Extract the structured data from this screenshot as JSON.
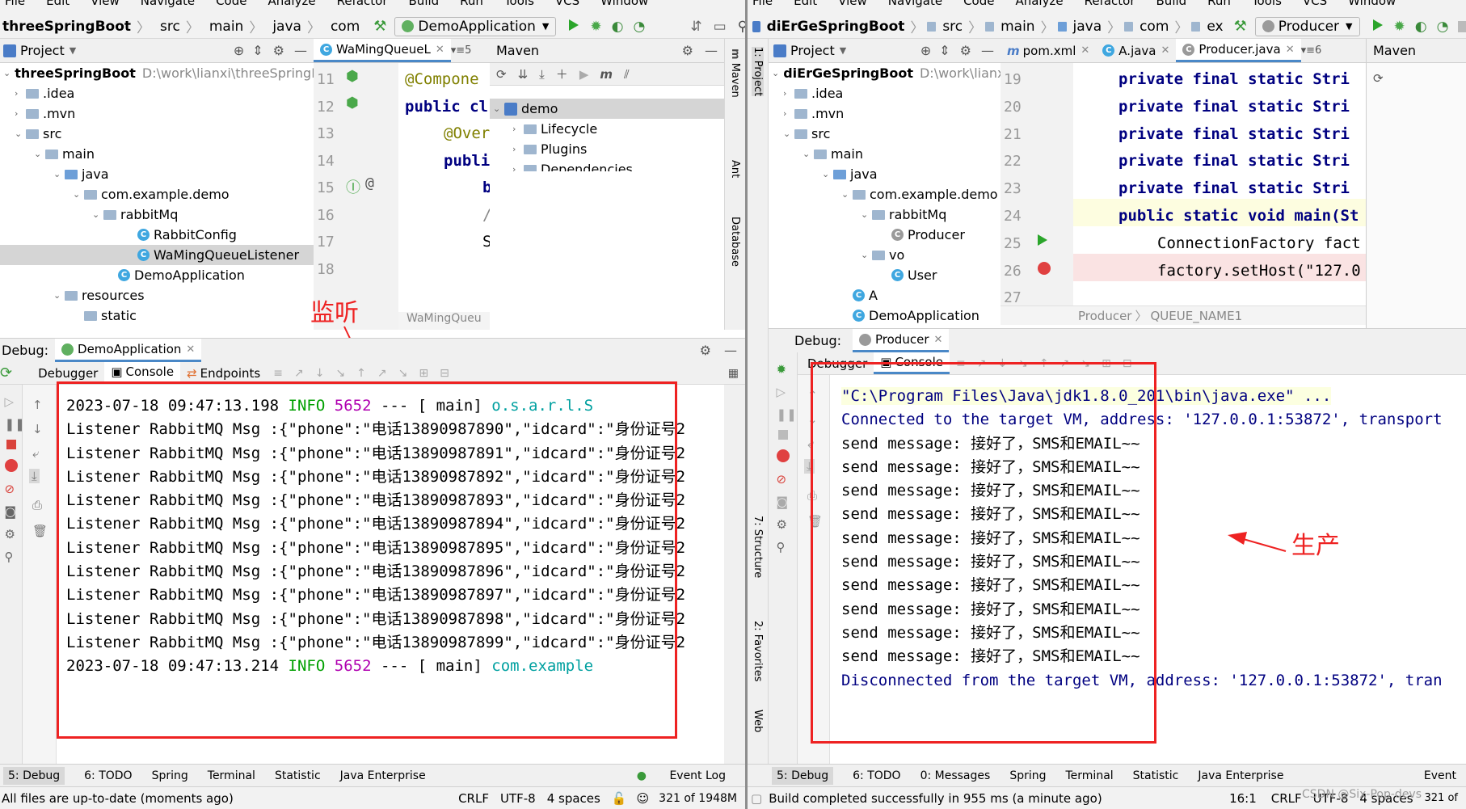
{
  "left": {
    "menu": [
      "File",
      "Edit",
      "View",
      "Navigate",
      "Code",
      "Analyze",
      "Refactor",
      "Build",
      "Run",
      "Tools",
      "VCS",
      "Window"
    ],
    "breadcrumb": [
      "threeSpringBoot",
      "src",
      "main",
      "java",
      "com"
    ],
    "run_config": "DemoApplication",
    "project_header": "Project",
    "editor_tab": "WaMingQueueL",
    "editor_tab_count": "5",
    "tree": {
      "root": "threeSpringBoot",
      "root_path": "D:\\work\\lianxi\\threeSpringBo",
      "items": [
        ".idea",
        ".mvn",
        "src",
        "main",
        "java",
        "com.example.demo",
        "rabbitMq",
        "RabbitConfig",
        "WaMingQueueListener",
        "DemoApplication",
        "resources",
        "static"
      ]
    },
    "code": {
      "line_numbers": [
        "11",
        "12",
        "13",
        "14",
        "15",
        "16",
        "17",
        "18"
      ],
      "lines": [
        "@Compone",
        "public cl",
        "",
        "@Over",
        "publi",
        "b",
        "/",
        "S"
      ],
      "footer": "WaMingQueu"
    },
    "maven": {
      "title": "Maven",
      "root": "demo",
      "items": [
        "Lifecycle",
        "Plugins",
        "Dependencies"
      ]
    },
    "side_tabs": [
      "Maven",
      "Ant",
      "Database"
    ],
    "debug": {
      "label": "Debug:",
      "config": "DemoApplication",
      "tabs": [
        "Debugger",
        "Console",
        "Endpoints"
      ]
    },
    "console": [
      {
        "pre": "2023-07-18 09:47:13.198  ",
        "level": "INFO",
        "pid": "5652",
        "mid": " --- [           main] ",
        "logger": "o.s.a.r.l.S"
      },
      {
        "text": "Listener RabbitMQ Msg :{\"phone\":\"电话13890987890\",\"idcard\":\"身份证号2"
      },
      {
        "text": "Listener RabbitMQ Msg :{\"phone\":\"电话13890987891\",\"idcard\":\"身份证号2"
      },
      {
        "text": "Listener RabbitMQ Msg :{\"phone\":\"电话13890987892\",\"idcard\":\"身份证号2"
      },
      {
        "text": "Listener RabbitMQ Msg :{\"phone\":\"电话13890987893\",\"idcard\":\"身份证号2"
      },
      {
        "text": "Listener RabbitMQ Msg :{\"phone\":\"电话13890987894\",\"idcard\":\"身份证号2"
      },
      {
        "text": "Listener RabbitMQ Msg :{\"phone\":\"电话13890987895\",\"idcard\":\"身份证号2"
      },
      {
        "text": "Listener RabbitMQ Msg :{\"phone\":\"电话13890987896\",\"idcard\":\"身份证号2"
      },
      {
        "text": "Listener RabbitMQ Msg :{\"phone\":\"电话13890987897\",\"idcard\":\"身份证号2"
      },
      {
        "text": "Listener RabbitMQ Msg :{\"phone\":\"电话13890987898\",\"idcard\":\"身份证号2"
      },
      {
        "text": "Listener RabbitMQ Msg :{\"phone\":\"电话13890987899\",\"idcard\":\"身份证号2"
      },
      {
        "pre": "2023-07-18 09:47:13.214  ",
        "level": "INFO",
        "pid": "5652",
        "mid": " --- [           main] ",
        "logger": "com.example"
      }
    ],
    "annotation": "监听",
    "bottom_tabs": [
      "5: Debug",
      "6: TODO",
      "Spring",
      "Terminal",
      "Statistic",
      "Java Enterprise",
      "Event Log"
    ],
    "status": {
      "message": "All files are up-to-date (moments ago)",
      "line_sep": "CRLF",
      "encoding": "UTF-8",
      "indent": "4 spaces",
      "memory": "321 of 1948M"
    }
  },
  "right": {
    "menu": [
      "File",
      "Edit",
      "View",
      "Navigate",
      "Code",
      "Analyze",
      "Refactor",
      "Build",
      "Run",
      "Tools",
      "VCS",
      "Window"
    ],
    "breadcrumb": [
      "diErGeSpringBoot",
      "src",
      "main",
      "java",
      "com",
      "ex"
    ],
    "run_config": "Producer",
    "project_header": "Project",
    "editor_tabs": [
      "pom.xml",
      "A.java",
      "Producer.java"
    ],
    "editor_tab_count": "6",
    "maven_header": "Maven",
    "tree": {
      "root": "diErGeSpringBoot",
      "root_path": "D:\\work\\lianxi\\diErGeSp",
      "items": [
        ".idea",
        ".mvn",
        "src",
        "main",
        "java",
        "com.example.demo",
        "rabbitMq",
        "Producer",
        "vo",
        "User",
        "A",
        "DemoApplication"
      ]
    },
    "code": {
      "line_numbers": [
        "19",
        "20",
        "21",
        "22",
        "23",
        "24",
        "25",
        "26",
        "27"
      ],
      "lines": [
        "private final static Stri",
        "private final static Stri",
        "private final static Stri",
        "private final static Stri",
        "private final static Stri",
        "",
        "public static void main(St",
        "ConnectionFactory fact",
        "factory.setHost(\"127.0"
      ],
      "footer_class": "Producer",
      "footer_field": "QUEUE_NAME1"
    },
    "side_tabs": [
      "1: Project",
      "7: Structure",
      "2: Favorites",
      "Web"
    ],
    "debug": {
      "label": "Debug:",
      "config": "Producer",
      "tabs": [
        "Debugger",
        "Console"
      ]
    },
    "console": {
      "cmd": "\"C:\\Program Files\\Java\\jdk1.8.0_201\\bin\\java.exe\" ...",
      "connected": "Connected to the target VM, address: '127.0.0.1:53872', transport",
      "messages": [
        "send message: 接好了，SMS和EMAIL~~",
        "send message: 接好了，SMS和EMAIL~~",
        "send message: 接好了，SMS和EMAIL~~",
        "send message: 接好了，SMS和EMAIL~~",
        "send message: 接好了，SMS和EMAIL~~",
        "send message: 接好了，SMS和EMAIL~~",
        "send message: 接好了，SMS和EMAIL~~",
        "send message: 接好了，SMS和EMAIL~~",
        "send message: 接好了，SMS和EMAIL~~",
        "send message: 接好了，SMS和EMAIL~~"
      ],
      "disconnected": "Disconnected from the target VM, address: '127.0.0.1:53872', tran"
    },
    "annotation": "生产",
    "bottom_tabs": [
      "5: Debug",
      "6: TODO",
      "0: Messages",
      "Spring",
      "Terminal",
      "Statistic",
      "Java Enterprise",
      "Event"
    ],
    "status": {
      "message": "Build completed successfully in 955 ms (a minute ago)",
      "position": "16:1",
      "line_sep": "CRLF",
      "encoding": "UTF-8",
      "indent": "4 spaces",
      "watermark": "CSDN @Six-Pop-devs",
      "memory": "321 of"
    }
  }
}
